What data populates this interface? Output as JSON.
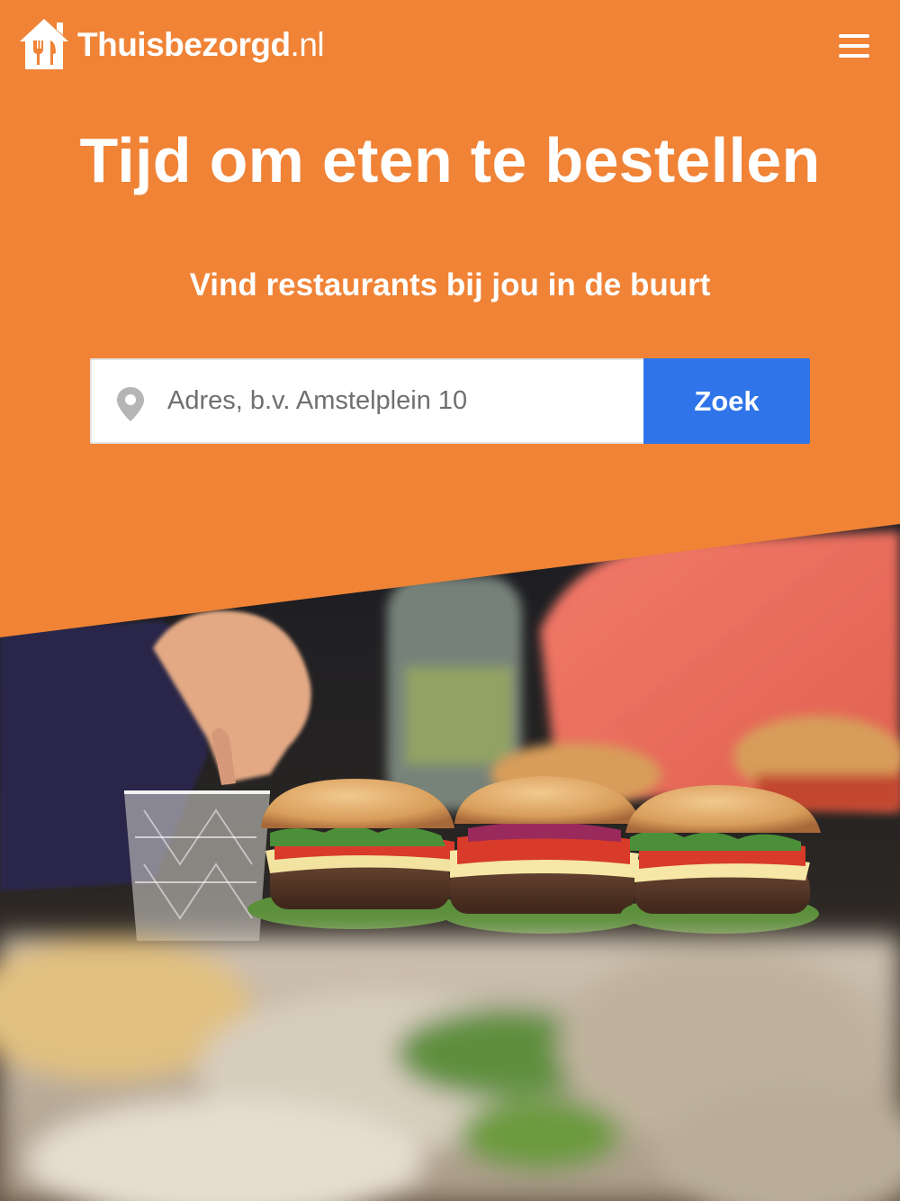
{
  "header": {
    "brand_name": "Thuisbezorgd",
    "brand_tld": ".nl",
    "menu_icon": "hamburger-menu-icon"
  },
  "hero": {
    "title": "Tijd om eten te bestellen",
    "subtitle": "Vind restaurants bij jou in de buurt"
  },
  "search": {
    "placeholder": "Adres, b.v. Amstelplein 10",
    "value": "",
    "button_label": "Zoek",
    "location_icon": "map-pin-icon"
  },
  "photo": {
    "subject": "burgers-on-table-photo"
  },
  "colors": {
    "brand_orange": "#f08336",
    "button_blue": "#2f74e8",
    "white": "#ffffff"
  }
}
